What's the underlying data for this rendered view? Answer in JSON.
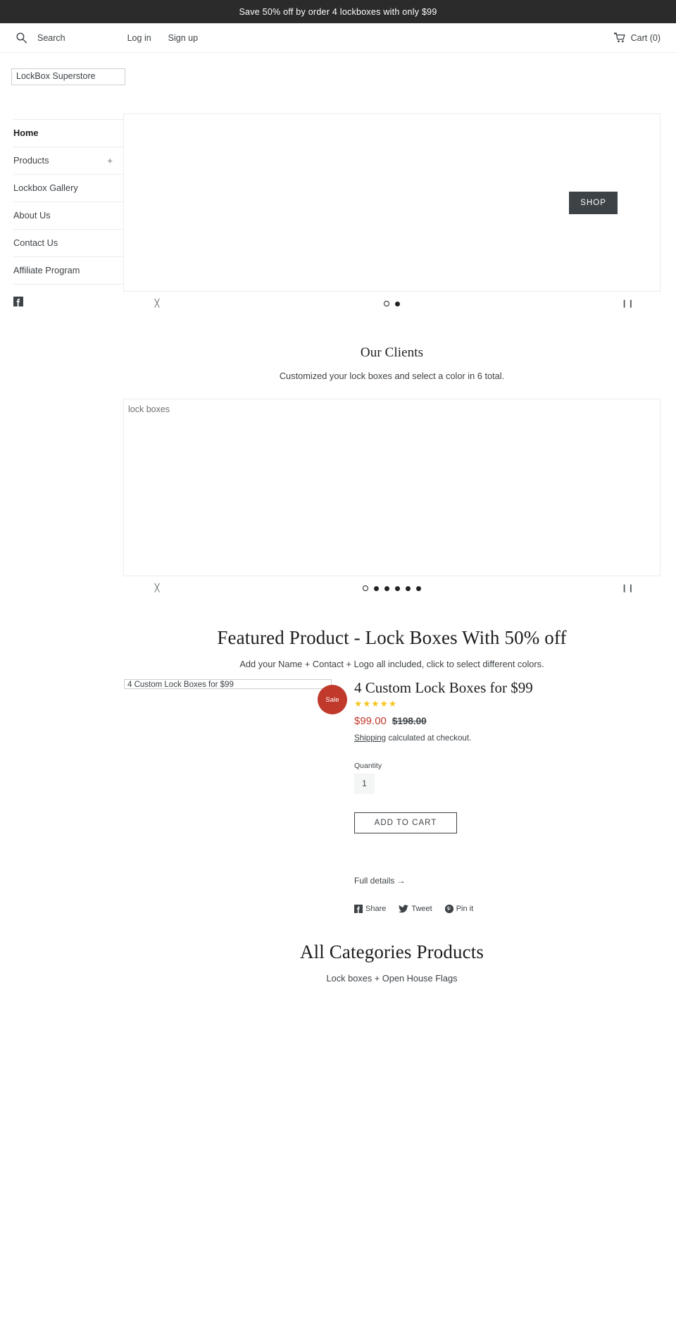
{
  "announcement": {
    "text": "Save 50% off by order 4 lockboxes with only $99"
  },
  "header": {
    "search_label": "Search",
    "search_icon": "search-icon",
    "login_label": "Log in",
    "signup_label": "Sign up",
    "cart_label": "Cart (0)",
    "cart_icon": "cart-icon"
  },
  "branding": {
    "shop_name": "LockBox Superstore"
  },
  "sidebar": {
    "items": [
      {
        "label": "Home",
        "active": true,
        "expandable": false
      },
      {
        "label": "Products",
        "active": false,
        "expandable": true,
        "expand_glyph": "+"
      },
      {
        "label": "Lockbox Gallery",
        "active": false,
        "expandable": false
      },
      {
        "label": "About Us",
        "active": false,
        "expandable": false
      },
      {
        "label": "Contact Us",
        "active": false,
        "expandable": false
      },
      {
        "label": "Affiliate Program",
        "active": false,
        "expandable": false
      }
    ],
    "social": [
      {
        "name": "facebook-icon",
        "glyph": "f"
      }
    ]
  },
  "hero_slideshow": {
    "shop_button_label": "SHOP",
    "controls": {
      "prev_glyph": "╳",
      "pause_glyph": "❙❙",
      "dots": [
        {
          "state": "open"
        },
        {
          "state": "filled"
        }
      ]
    }
  },
  "clients_section": {
    "heading": "Our Clients",
    "subtitle": "Customized your lock boxes and select a color in 6 total.",
    "gallery_alt": "lock boxes",
    "controls": {
      "prev_glyph": "╳",
      "pause_glyph": "❙❙",
      "dots": [
        {
          "state": "open"
        },
        {
          "state": "filled"
        },
        {
          "state": "filled"
        },
        {
          "state": "filled"
        },
        {
          "state": "filled"
        },
        {
          "state": "filled"
        }
      ]
    }
  },
  "featured": {
    "heading": "Featured Product - Lock Boxes With 50% off",
    "subtitle": "Add your Name + Contact + Logo all included, click to select different colors.",
    "media_alt": "4 Custom Lock Boxes for $99",
    "sale_badge": "Sale",
    "product_title": "4 Custom Lock Boxes for $99",
    "rating_stars": "★★★★★",
    "rating_value": 5,
    "price_sale": "$99.00",
    "price_compare": "$198.00",
    "shipping_link": "Shipping",
    "shipping_rest": " calculated at checkout.",
    "quantity_label": "Quantity",
    "quantity_value": "1",
    "add_to_cart_label": "ADD TO CART",
    "full_details_label": "Full details →",
    "share": [
      {
        "label": "Share",
        "icon": "facebook-icon"
      },
      {
        "label": "Tweet",
        "icon": "twitter-icon"
      },
      {
        "label": "Pin it",
        "icon": "pinterest-icon"
      }
    ]
  },
  "categories_section": {
    "heading": "All Categories Products",
    "subtitle": "Lock boxes + Open House Flags"
  },
  "colors": {
    "announcement_bg": "#2b2b2b",
    "text": "#3d4246",
    "sale_red": "#c0392b",
    "star_yellow": "#f5c518",
    "button_dark": "#3d4246",
    "border": "#ececec"
  }
}
